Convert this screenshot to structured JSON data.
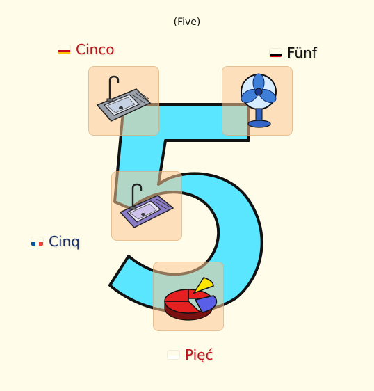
{
  "subtitle": "(Five)",
  "digit": "5",
  "colors": {
    "background": "#fffde9",
    "digit_fill": "#5ae6ff",
    "tile_fill": "#fcc896",
    "spanish_text": "#c0121a",
    "german_text": "#111111",
    "french_text": "#1a2f6b",
    "polish_text": "#c0121a"
  },
  "words": {
    "spanish": {
      "label": "Cinco",
      "flag": "spain-flag"
    },
    "german": {
      "label": "Fünf",
      "flag": "germany-flag"
    },
    "french": {
      "label": "Cinq",
      "flag": "france-flag"
    },
    "polish": {
      "label": "Pięć",
      "flag": "poland-flag"
    }
  },
  "tiles": [
    {
      "icon": "kitchen-sink-icon"
    },
    {
      "icon": "electric-fan-icon"
    },
    {
      "icon": "kitchen-sink-icon"
    },
    {
      "icon": "pie-chart-icon"
    }
  ]
}
